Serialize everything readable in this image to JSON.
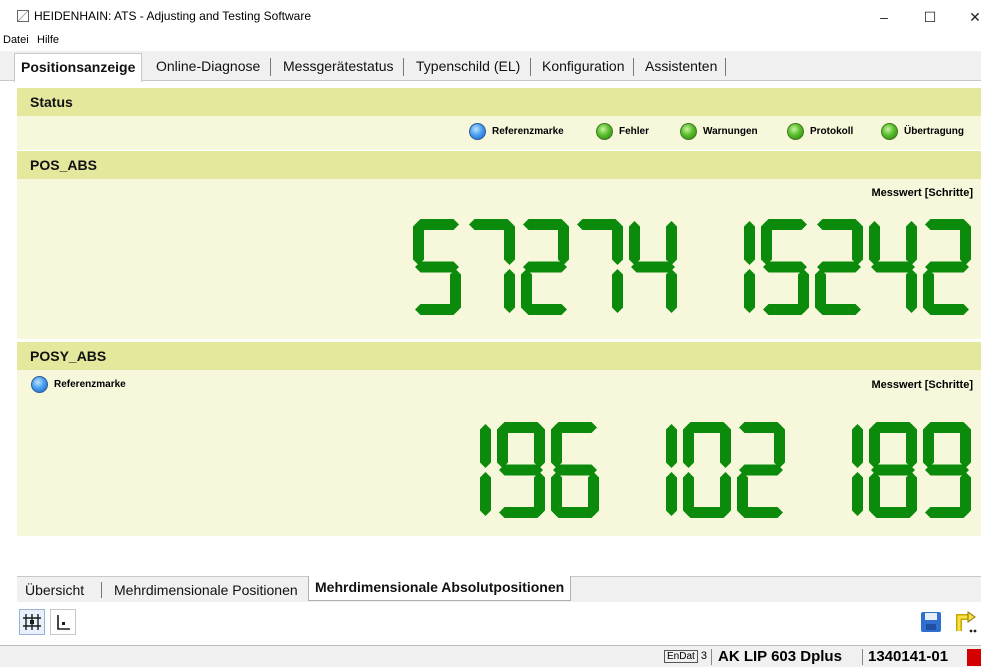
{
  "window": {
    "title": "HEIDENHAIN: ATS - Adjusting and Testing Software",
    "minimize": "–",
    "maximize": "☐",
    "close": "✕"
  },
  "menu": [
    "Datei",
    "Hilfe"
  ],
  "tabs": [
    {
      "label": "Positionsanzeige",
      "active": true
    },
    {
      "label": "Online-Diagnose",
      "active": false
    },
    {
      "label": "Messgerätestatus",
      "active": false
    },
    {
      "label": "Typenschild (EL)",
      "active": false
    },
    {
      "label": "Konfiguration",
      "active": false
    },
    {
      "label": "Assistenten",
      "active": false
    }
  ],
  "status_section": {
    "header": "Status",
    "indicators": [
      {
        "label": "Referenzmarke",
        "color": "blue"
      },
      {
        "label": "Fehler",
        "color": "green"
      },
      {
        "label": "Warnungen",
        "color": "green"
      },
      {
        "label": "Protokoll",
        "color": "green"
      },
      {
        "label": "Übertragung",
        "color": "green"
      }
    ]
  },
  "pos_abs": {
    "header": "POS_ABS",
    "unit_label": "Messwert [Schritte]",
    "value": "57274 15242"
  },
  "posy_abs": {
    "header": "POSY_ABS",
    "indicator_label": "Referenzmarke",
    "unit_label": "Messwert [Schritte]",
    "value": "196 102 189"
  },
  "bottom_tabs": [
    {
      "label": "Übersicht",
      "active": false
    },
    {
      "label": "Mehrdimensionale Positionen",
      "active": false
    },
    {
      "label": "Mehrdimensionale Absolutpositionen",
      "active": true
    }
  ],
  "toolbar": {
    "left_icons": [
      "grid-icon",
      "axis-icon"
    ],
    "right_icons": [
      "save-icon",
      "exit-icon"
    ]
  },
  "statusbar": {
    "interface_prefix": "EnDat",
    "interface_version": "3",
    "device": "AK LIP 603 Dplus",
    "id": "1340141-01"
  },
  "colors": {
    "section_header": "#e3e89d",
    "section_body": "#f6f7db",
    "digit_green": "#0b8a0b",
    "led_blue": "#4aa0f0",
    "led_green": "#59bf2b"
  }
}
